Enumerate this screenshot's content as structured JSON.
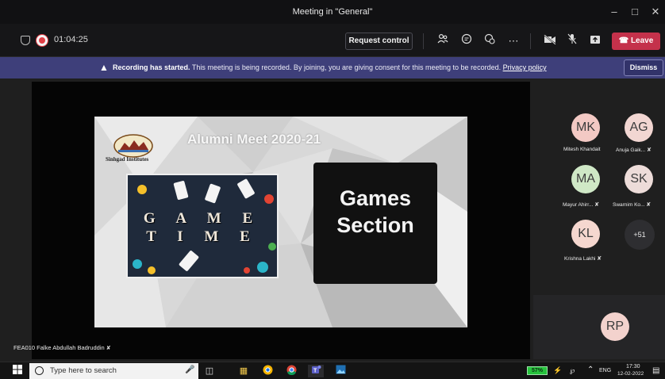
{
  "window": {
    "title": "Meeting in \"General\"",
    "minimize_icon": "–",
    "maximize_icon": "□",
    "close_icon": "✕"
  },
  "toolbar": {
    "timer": "01:04:25",
    "request_control_label": "Request control",
    "leave_label": "Leave",
    "icons": [
      "participants-icon",
      "chat-icon",
      "reactions-icon",
      "more-options-icon",
      "camera-off-icon",
      "mic-off-icon",
      "share-icon"
    ]
  },
  "banner": {
    "bold": "Recording has started.",
    "message": " This meeting is being recorded. By joining, you are giving consent for this meeting to be recorded. ",
    "link": "Privacy policy",
    "dismiss_label": "Dismiss",
    "color": "#3e3f7a"
  },
  "slide": {
    "title": "Alumni Meet  2020-21",
    "logo_text": "Sinhgad Institutes",
    "game_word_1": "G A M E",
    "game_word_2": "T I M E",
    "games_line_1": "Games",
    "games_line_2": "Section"
  },
  "presenter_caption": "FEA010 Falke Abdullah Badruddin",
  "participants": [
    {
      "initials": "MK",
      "name": "Mitesh Khandait",
      "color": "#f3c9c4",
      "muted": false
    },
    {
      "initials": "AG",
      "name": "Anuja Gaik...",
      "color": "#f2d6d2",
      "muted": true
    },
    {
      "initials": "MA",
      "name": "Mayur Ahirr...",
      "color": "#cfe8c6",
      "muted": true
    },
    {
      "initials": "SK",
      "name": "Swarnim Ko...",
      "color": "#eddcd9",
      "muted": true
    },
    {
      "initials": "KL",
      "name": "Krishna Lakhi",
      "color": "#f5d7cf",
      "muted": true
    }
  ],
  "more_participants": "+51",
  "self_tile": {
    "initials": "RP",
    "color": "#f3d2cd"
  },
  "taskbar": {
    "search_placeholder": "Type here to search",
    "battery": "57%",
    "language": "ENG",
    "time": "17:30",
    "date": "12-02-2022"
  }
}
